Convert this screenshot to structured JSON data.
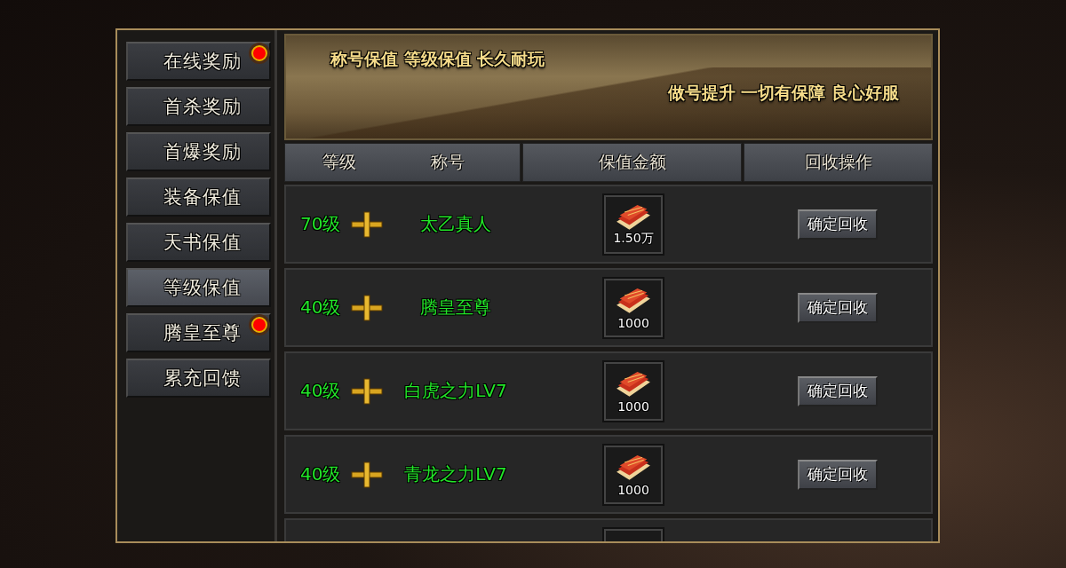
{
  "sidebar": {
    "items": [
      {
        "label": "在线奖励",
        "selected": false,
        "badge": true
      },
      {
        "label": "首杀奖励",
        "selected": false,
        "badge": false
      },
      {
        "label": "首爆奖励",
        "selected": false,
        "badge": false
      },
      {
        "label": "装备保值",
        "selected": false,
        "badge": false
      },
      {
        "label": "天书保值",
        "selected": false,
        "badge": false
      },
      {
        "label": "等级保值",
        "selected": true,
        "badge": false
      },
      {
        "label": "腾皇至尊",
        "selected": false,
        "badge": true
      },
      {
        "label": "累充回馈",
        "selected": false,
        "badge": false
      }
    ]
  },
  "banner": {
    "lines": [
      "称号**保值** 等级**保值** 长久**耐玩**",
      "做号**提升** 一切有**保障** **良心**好服"
    ]
  },
  "table": {
    "columns": [
      {
        "labels": [
          "等级",
          "称号"
        ]
      },
      {
        "labels": [
          "保值金额"
        ]
      },
      {
        "labels": [
          "回收操作"
        ]
      }
    ],
    "rows": [
      {
        "level": "70级",
        "title": "太乙真人",
        "amount": "1.50万",
        "action": "确定回收"
      },
      {
        "level": "40级",
        "title": "腾皇至尊",
        "amount": "1000",
        "action": "确定回收"
      },
      {
        "level": "40级",
        "title": "白虎之力LV7",
        "amount": "1000",
        "action": "确定回收"
      },
      {
        "level": "40级",
        "title": "青龙之力LV7",
        "amount": "1000",
        "action": "确定回收"
      }
    ]
  }
}
